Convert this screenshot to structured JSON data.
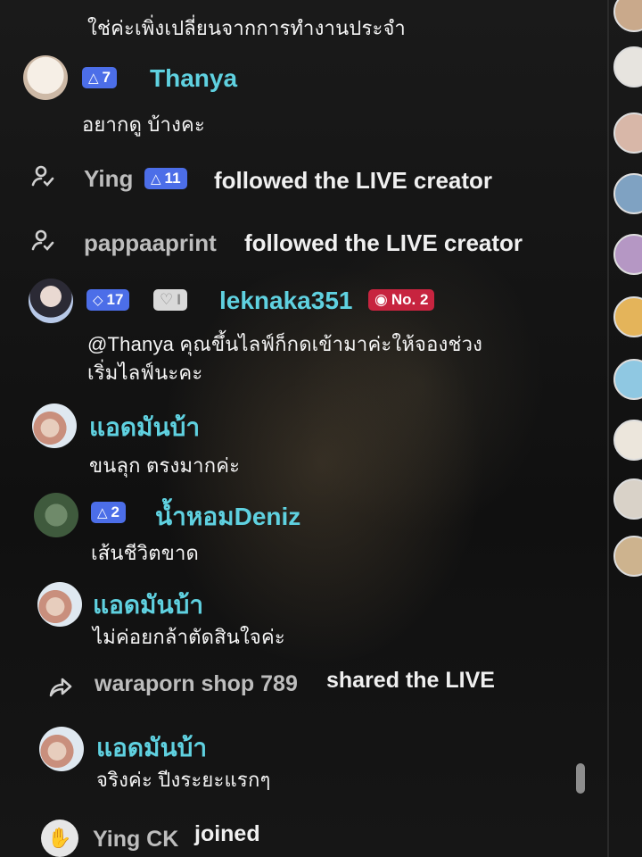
{
  "messages": [
    {
      "type": "text",
      "message": "ใช่ค่ะเพิ่งเปลี่ยนจากการทำงานประจำ"
    },
    {
      "type": "chat",
      "name": "Thanya",
      "level": "7",
      "message": "อยากดู บ้างคะ"
    },
    {
      "type": "system",
      "name": "Ying",
      "level": "11",
      "action": "followed the LIVE creator"
    },
    {
      "type": "system",
      "name": "pappaaprint",
      "action": "followed the LIVE creator"
    },
    {
      "type": "chat",
      "name": "leknaka351",
      "level": "17",
      "fan_level": "I",
      "rank": "No. 2",
      "message_line1": "@Thanya คุณขึ้นไลฟ์ก็กดเข้ามาค่ะให้จองช่วง",
      "message_line2": "เริ่มไลฟ์นะคะ"
    },
    {
      "type": "chat",
      "name": "แอดมันบ้า",
      "message": "ขนลุก ตรงมากค่ะ"
    },
    {
      "type": "chat",
      "name": "น้ำหอมDeniz",
      "level": "2",
      "message": "เส้นชีวิตขาด"
    },
    {
      "type": "chat",
      "name": "แอดมันบ้า",
      "message": "ไม่ค่อยกล้าตัดสินใจค่ะ"
    },
    {
      "type": "system",
      "name": "waraporn shop 789",
      "action": "shared the LIVE"
    },
    {
      "type": "chat",
      "name": "แอดมันบ้า",
      "message": "จริงค่ะ ปีงระยะแรกๆ"
    },
    {
      "type": "system",
      "name": "Ying CK",
      "action": "joined"
    }
  ],
  "colors": {
    "username": "#5fd1e0",
    "level_badge": "#4c6ee8",
    "rank_badge": "#c7243f",
    "background": "#121212"
  },
  "icons": {
    "follow": "user-follow-icon",
    "share": "share-arrow-icon",
    "joined": "waving-hand-icon"
  }
}
